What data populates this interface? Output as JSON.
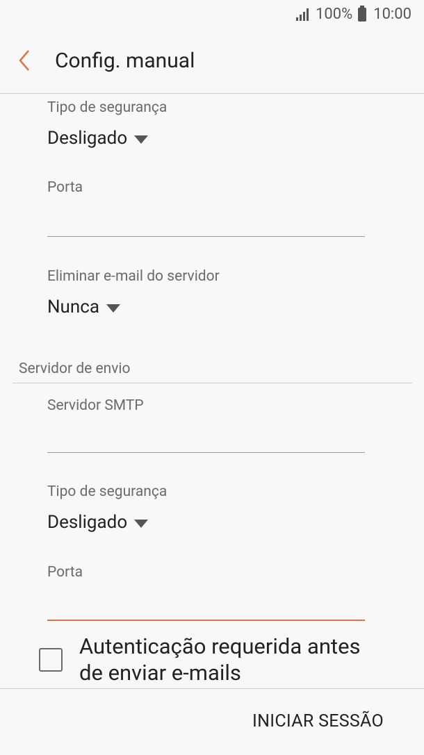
{
  "status_bar": {
    "battery": "100%",
    "time": "10:00"
  },
  "header": {
    "title": "Config. manual"
  },
  "incoming": {
    "security_label": "Tipo de segurança",
    "security_value": "Desligado",
    "port_label": "Porta",
    "port_value": "",
    "delete_label": "Eliminar e-mail do servidor",
    "delete_value": "Nunca"
  },
  "outgoing": {
    "section_title": "Servidor de envio",
    "smtp_label": "Servidor SMTP",
    "smtp_value": "",
    "security_label": "Tipo de segurança",
    "security_value": "Desligado",
    "port_label": "Porta",
    "port_value": "",
    "auth_label": "Autenticação requerida antes de enviar e-mails",
    "auth_checked": false
  },
  "footer": {
    "login_button": "INICIAR SESSÃO"
  },
  "colors": {
    "accent": "#e07446",
    "background": "#f8f8f8",
    "divider": "#cfcfcf"
  }
}
